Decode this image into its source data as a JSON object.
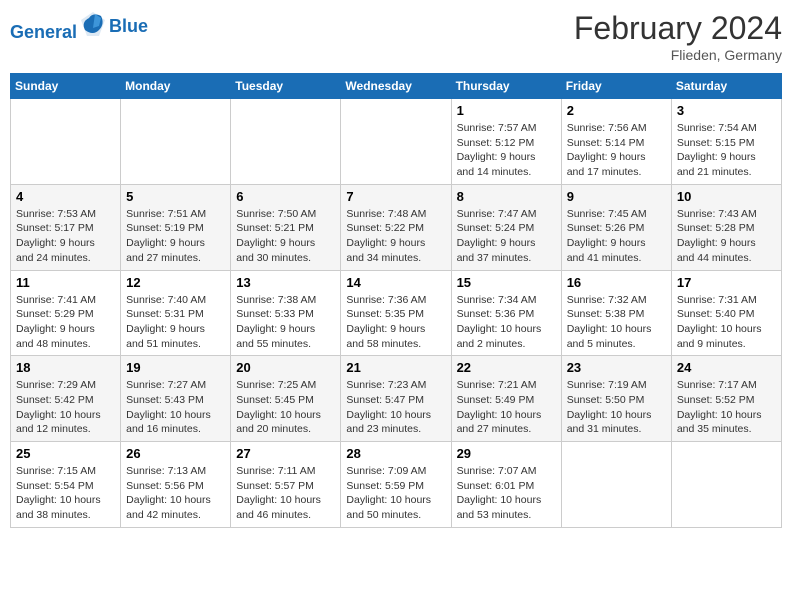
{
  "logo": {
    "line1": "General",
    "line2": "Blue"
  },
  "title": "February 2024",
  "location": "Flieden, Germany",
  "days_of_week": [
    "Sunday",
    "Monday",
    "Tuesday",
    "Wednesday",
    "Thursday",
    "Friday",
    "Saturday"
  ],
  "weeks": [
    [
      {
        "day": "",
        "info": ""
      },
      {
        "day": "",
        "info": ""
      },
      {
        "day": "",
        "info": ""
      },
      {
        "day": "",
        "info": ""
      },
      {
        "day": "1",
        "info": "Sunrise: 7:57 AM\nSunset: 5:12 PM\nDaylight: 9 hours\nand 14 minutes."
      },
      {
        "day": "2",
        "info": "Sunrise: 7:56 AM\nSunset: 5:14 PM\nDaylight: 9 hours\nand 17 minutes."
      },
      {
        "day": "3",
        "info": "Sunrise: 7:54 AM\nSunset: 5:15 PM\nDaylight: 9 hours\nand 21 minutes."
      }
    ],
    [
      {
        "day": "4",
        "info": "Sunrise: 7:53 AM\nSunset: 5:17 PM\nDaylight: 9 hours\nand 24 minutes."
      },
      {
        "day": "5",
        "info": "Sunrise: 7:51 AM\nSunset: 5:19 PM\nDaylight: 9 hours\nand 27 minutes."
      },
      {
        "day": "6",
        "info": "Sunrise: 7:50 AM\nSunset: 5:21 PM\nDaylight: 9 hours\nand 30 minutes."
      },
      {
        "day": "7",
        "info": "Sunrise: 7:48 AM\nSunset: 5:22 PM\nDaylight: 9 hours\nand 34 minutes."
      },
      {
        "day": "8",
        "info": "Sunrise: 7:47 AM\nSunset: 5:24 PM\nDaylight: 9 hours\nand 37 minutes."
      },
      {
        "day": "9",
        "info": "Sunrise: 7:45 AM\nSunset: 5:26 PM\nDaylight: 9 hours\nand 41 minutes."
      },
      {
        "day": "10",
        "info": "Sunrise: 7:43 AM\nSunset: 5:28 PM\nDaylight: 9 hours\nand 44 minutes."
      }
    ],
    [
      {
        "day": "11",
        "info": "Sunrise: 7:41 AM\nSunset: 5:29 PM\nDaylight: 9 hours\nand 48 minutes."
      },
      {
        "day": "12",
        "info": "Sunrise: 7:40 AM\nSunset: 5:31 PM\nDaylight: 9 hours\nand 51 minutes."
      },
      {
        "day": "13",
        "info": "Sunrise: 7:38 AM\nSunset: 5:33 PM\nDaylight: 9 hours\nand 55 minutes."
      },
      {
        "day": "14",
        "info": "Sunrise: 7:36 AM\nSunset: 5:35 PM\nDaylight: 9 hours\nand 58 minutes."
      },
      {
        "day": "15",
        "info": "Sunrise: 7:34 AM\nSunset: 5:36 PM\nDaylight: 10 hours\nand 2 minutes."
      },
      {
        "day": "16",
        "info": "Sunrise: 7:32 AM\nSunset: 5:38 PM\nDaylight: 10 hours\nand 5 minutes."
      },
      {
        "day": "17",
        "info": "Sunrise: 7:31 AM\nSunset: 5:40 PM\nDaylight: 10 hours\nand 9 minutes."
      }
    ],
    [
      {
        "day": "18",
        "info": "Sunrise: 7:29 AM\nSunset: 5:42 PM\nDaylight: 10 hours\nand 12 minutes."
      },
      {
        "day": "19",
        "info": "Sunrise: 7:27 AM\nSunset: 5:43 PM\nDaylight: 10 hours\nand 16 minutes."
      },
      {
        "day": "20",
        "info": "Sunrise: 7:25 AM\nSunset: 5:45 PM\nDaylight: 10 hours\nand 20 minutes."
      },
      {
        "day": "21",
        "info": "Sunrise: 7:23 AM\nSunset: 5:47 PM\nDaylight: 10 hours\nand 23 minutes."
      },
      {
        "day": "22",
        "info": "Sunrise: 7:21 AM\nSunset: 5:49 PM\nDaylight: 10 hours\nand 27 minutes."
      },
      {
        "day": "23",
        "info": "Sunrise: 7:19 AM\nSunset: 5:50 PM\nDaylight: 10 hours\nand 31 minutes."
      },
      {
        "day": "24",
        "info": "Sunrise: 7:17 AM\nSunset: 5:52 PM\nDaylight: 10 hours\nand 35 minutes."
      }
    ],
    [
      {
        "day": "25",
        "info": "Sunrise: 7:15 AM\nSunset: 5:54 PM\nDaylight: 10 hours\nand 38 minutes."
      },
      {
        "day": "26",
        "info": "Sunrise: 7:13 AM\nSunset: 5:56 PM\nDaylight: 10 hours\nand 42 minutes."
      },
      {
        "day": "27",
        "info": "Sunrise: 7:11 AM\nSunset: 5:57 PM\nDaylight: 10 hours\nand 46 minutes."
      },
      {
        "day": "28",
        "info": "Sunrise: 7:09 AM\nSunset: 5:59 PM\nDaylight: 10 hours\nand 50 minutes."
      },
      {
        "day": "29",
        "info": "Sunrise: 7:07 AM\nSunset: 6:01 PM\nDaylight: 10 hours\nand 53 minutes."
      },
      {
        "day": "",
        "info": ""
      },
      {
        "day": "",
        "info": ""
      }
    ]
  ]
}
